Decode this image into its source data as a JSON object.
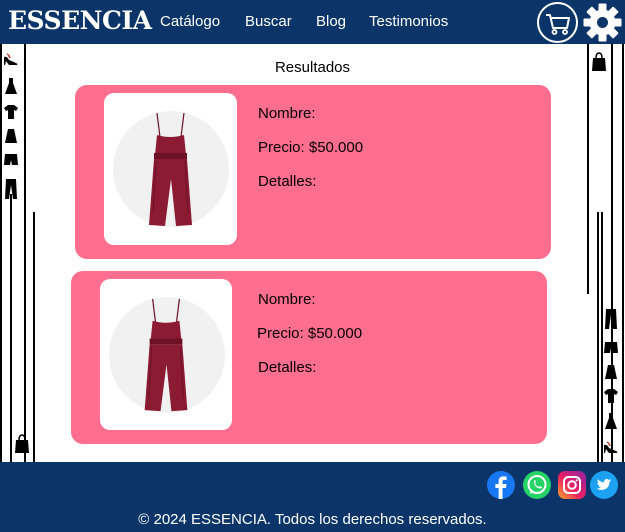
{
  "header": {
    "brand": "ESSENCIA",
    "nav": [
      "Catálogo",
      "Buscar",
      "Blog",
      "Testimonios"
    ],
    "cart_icon": "shopping-cart-icon",
    "settings_icon": "gear-icon"
  },
  "main": {
    "title": "Resultados",
    "products": [
      {
        "name_label": "Nombre:",
        "price_label": "Precio: $50.000",
        "details_label": "Detalles:"
      },
      {
        "name_label": "Nombre:",
        "price_label": "Precio: $50.000",
        "details_label": "Detalles:"
      }
    ]
  },
  "footer": {
    "social": [
      "facebook-icon",
      "whatsapp-icon",
      "instagram-icon",
      "twitter-icon"
    ],
    "copyright": "© 2024 ESSENCIA. Todos los derechos reservados."
  },
  "colors": {
    "header_bg": "#0b3568",
    "card_bg": "#ff6e8e",
    "product_color": "#8b1a33"
  }
}
